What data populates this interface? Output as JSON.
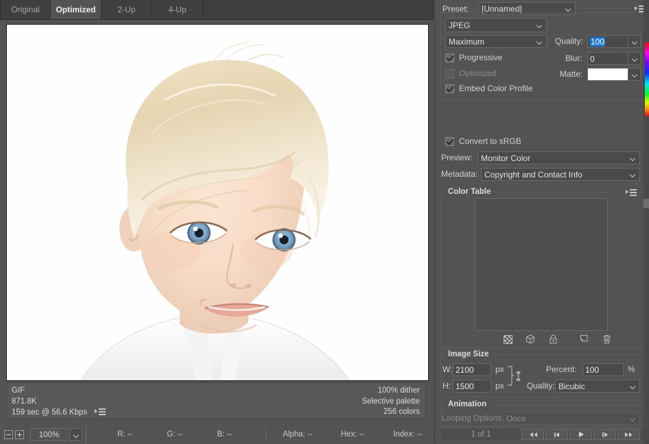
{
  "tabs": [
    {
      "label": "Original",
      "active": false
    },
    {
      "label": "Optimized",
      "active": true
    },
    {
      "label": "2-Up",
      "active": false
    },
    {
      "label": "4-Up",
      "active": false
    }
  ],
  "preview_status": {
    "format": "GIF",
    "filesize": "871.8K",
    "download_time": "159 sec @ 56.6 Kbps",
    "dither": "100% dither",
    "palette": "Selective palette",
    "colors": "256 colors"
  },
  "bottom_bar": {
    "zoom_level": "100%",
    "zoom_out_icon": "minus-icon",
    "zoom_in_icon": "plus-icon",
    "readouts": [
      {
        "label": "R:",
        "value": "--"
      },
      {
        "label": "G:",
        "value": "--"
      },
      {
        "label": "B:",
        "value": "--"
      },
      {
        "label": "Alpha:",
        "value": "--"
      },
      {
        "label": "Hex:",
        "value": "--"
      },
      {
        "label": "Index:",
        "value": "--"
      }
    ]
  },
  "settings": {
    "preset_label": "Preset:",
    "preset_value": "[Unnamed]",
    "format_value": "JPEG",
    "compression_value": "Maximum",
    "quality_label": "Quality:",
    "quality_value": "100",
    "progressive_label": "Progressive",
    "progressive_checked": true,
    "blur_label": "Blur:",
    "blur_value": "0",
    "optimized_label": "Optimized",
    "optimized_checked": false,
    "matte_label": "Matte:",
    "matte_color": "#ffffff",
    "embed_label": "Embed Color Profile",
    "embed_checked": true,
    "convert_srgb_label": "Convert to sRGB",
    "convert_srgb_checked": true,
    "preview_label": "Preview:",
    "preview_value": "Monitor Color",
    "metadata_label": "Metadata:",
    "metadata_value": "Copyright and Contact Info"
  },
  "color_table": {
    "title": "Color Table",
    "tools": [
      "transparency-icon",
      "web-shift-icon",
      "lock-icon",
      "new-color-icon",
      "trash-icon"
    ]
  },
  "image_size": {
    "title": "Image Size",
    "w_label": "W:",
    "w_value": "2100",
    "w_unit": "px",
    "h_label": "H:",
    "h_value": "1500",
    "h_unit": "px",
    "link_icon": "chain-link-icon",
    "percent_label": "Percent:",
    "percent_value": "100",
    "percent_unit": "%",
    "quality_label": "Quality:",
    "quality_value": "Bicubic"
  },
  "animation": {
    "title": "Animation",
    "looping_label": "Looping Options:",
    "looping_value": "Once",
    "frame_count": "1 of 1",
    "controls": [
      "first-frame-icon",
      "previous-frame-icon",
      "play-icon",
      "next-frame-icon",
      "last-frame-icon"
    ]
  },
  "colors": {
    "panel_bg": "#535353",
    "tabbar_bg": "#3f3f3f",
    "selection_blue": "#1a77d4",
    "field_bg": "#4a4a4a"
  }
}
